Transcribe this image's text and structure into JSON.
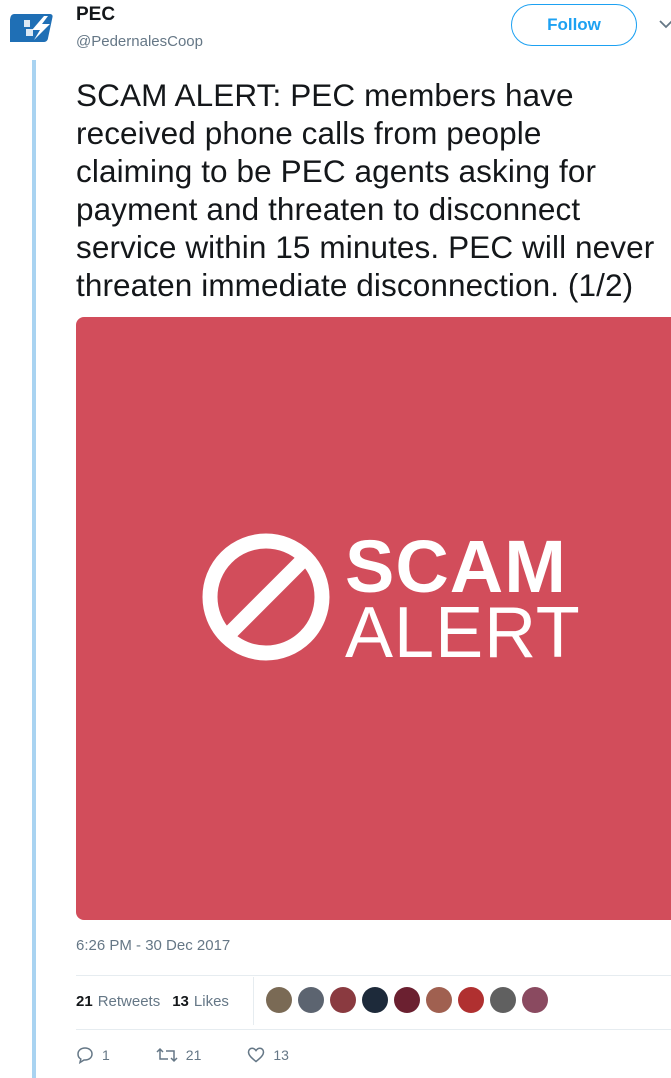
{
  "tweet": {
    "author_name": "PEC",
    "author_handle": "@PedernalesCoop",
    "follow_label": "Follow",
    "text": "SCAM ALERT: PEC members have\nreceived phone calls from people\nclaiming to be PEC agents asking for\npayment and threaten to disconnect\nservice within 15 minutes. PEC will never\nthreaten immediate disconnection. (1/2)",
    "media": {
      "line1": "SCAM",
      "line2": "ALERT",
      "background": "#d24d5b"
    },
    "timestamp": "6:26 PM - 30 Dec 2017",
    "stats": {
      "retweets_count": "21",
      "retweets_label": "Retweets",
      "likes_count": "13",
      "likes_label": "Likes"
    },
    "avatar_colors": [
      "#7a6a55",
      "#5c6470",
      "#8a3a40",
      "#1d2a3a",
      "#6b2030",
      "#a06050",
      "#b03030",
      "#606060",
      "#8a4a60"
    ],
    "actions": {
      "reply_count": "1",
      "retweet_count": "21",
      "like_count": "13"
    }
  },
  "colors": {
    "accent": "#1da1f2",
    "thread_line": "#a9d3f1",
    "secondary_text": "#657786"
  }
}
